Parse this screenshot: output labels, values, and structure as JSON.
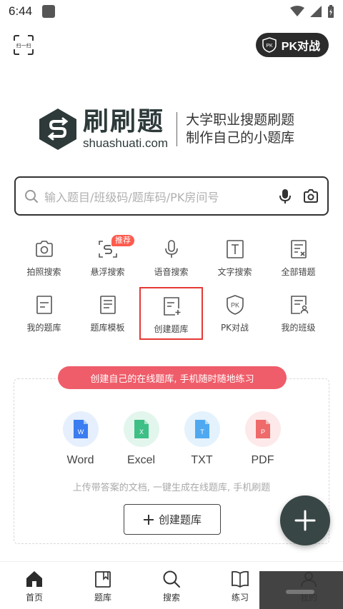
{
  "status_bar": {
    "time": "6:44"
  },
  "header": {
    "scan_label": "扫一扫",
    "pk_label": "PK对战",
    "pk_badge": "PK"
  },
  "logo": {
    "brand_cn": "刷刷题",
    "brand_en": "shuashuati.com",
    "slogan_line1": "大学职业搜题刷题",
    "slogan_line2": "制作自己的小题库"
  },
  "search": {
    "placeholder": "输入题目/班级码/题库码/PK房间号"
  },
  "tools": {
    "row1": [
      {
        "label": "拍照搜索",
        "icon": "camera-icon"
      },
      {
        "label": "悬浮搜索",
        "icon": "float-search-icon",
        "badge": "推荐"
      },
      {
        "label": "语音搜索",
        "icon": "microphone-icon"
      },
      {
        "label": "文字搜索",
        "icon": "text-icon"
      },
      {
        "label": "全部错题",
        "icon": "wrong-list-icon"
      }
    ],
    "row2": [
      {
        "label": "我的题库",
        "icon": "my-bank-icon"
      },
      {
        "label": "题库模板",
        "icon": "template-icon"
      },
      {
        "label": "创建题库",
        "icon": "create-bank-icon"
      },
      {
        "label": "PK对战",
        "icon": "pk-shield-icon"
      },
      {
        "label": "我的班级",
        "icon": "class-icon"
      }
    ]
  },
  "create_card": {
    "banner": "创建自己的在线题库, 手机随时随地练习",
    "formats": [
      {
        "label": "Word",
        "letter": "W",
        "color": "#3b7cf0",
        "bg": "#e6effd"
      },
      {
        "label": "Excel",
        "letter": "X",
        "color": "#3dbf86",
        "bg": "#e3f6ed"
      },
      {
        "label": "TXT",
        "letter": "T",
        "color": "#4fa9f0",
        "bg": "#e4f2fd"
      },
      {
        "label": "PDF",
        "letter": "P",
        "color": "#ef6a6a",
        "bg": "#fde9e9"
      }
    ],
    "description": "上传带答案的文档, 一键生成在线题库, 手机刷题",
    "button": "创建题库"
  },
  "bottom_nav": [
    {
      "label": "首页",
      "icon": "home-icon"
    },
    {
      "label": "题库",
      "icon": "book-icon"
    },
    {
      "label": "搜索",
      "icon": "search-icon"
    },
    {
      "label": "练习",
      "icon": "practice-icon"
    },
    {
      "label": "我的",
      "icon": "profile-icon"
    }
  ],
  "colors": {
    "accent": "#384645",
    "banner": "#ef5d6a",
    "badge": "#ff5a4e",
    "selection": "#e53935"
  }
}
